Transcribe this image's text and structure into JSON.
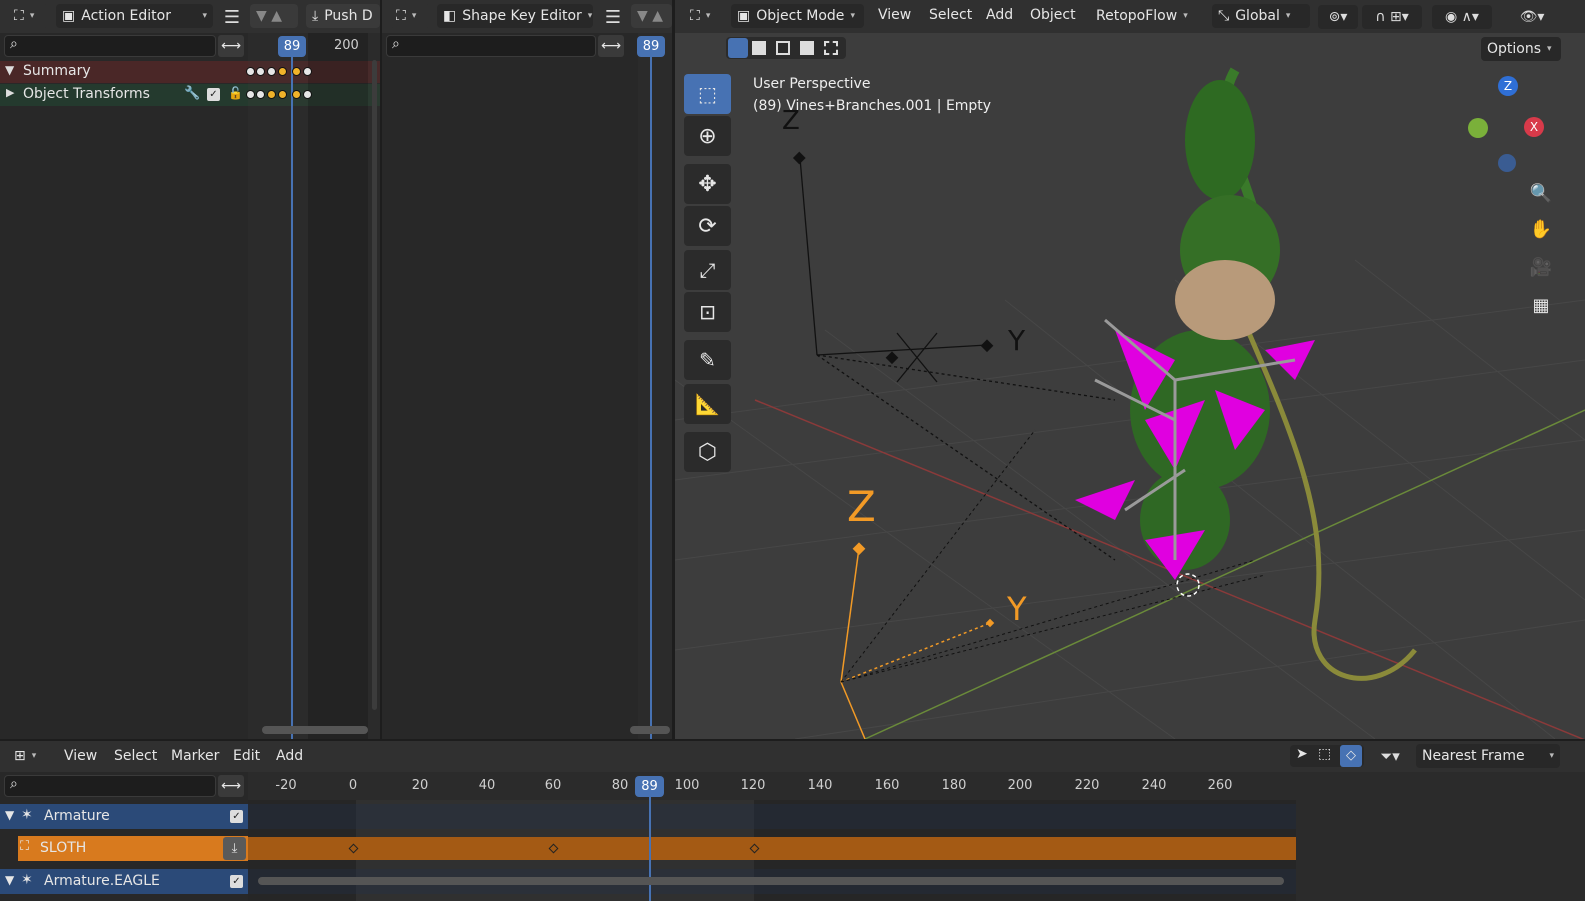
{
  "action_editor": {
    "mode": "Action Editor",
    "push_label": "Push D",
    "current_frame": "89",
    "frame_200": "200",
    "summary_label": "Summary",
    "object_transforms_label": "Object Transforms"
  },
  "shape_key_editor": {
    "mode": "Shape Key Editor",
    "current_frame": "89"
  },
  "viewport": {
    "mode": "Object Mode",
    "menus": [
      "View",
      "Select",
      "Add",
      "Object"
    ],
    "retopoflow": "RetopoFlow",
    "orientation": "Global",
    "options_label": "Options",
    "perspective": "User Perspective",
    "object_info": "(89) Vines+Branches.001 | Empty",
    "axis_labels": {
      "z_dim": "Z",
      "y_dim": "Y",
      "z_orange": "Z",
      "y_orange": "Y"
    },
    "gizmo": {
      "z": "Z",
      "x": "X"
    }
  },
  "nla": {
    "menus": [
      "View",
      "Select",
      "Marker",
      "Edit",
      "Add"
    ],
    "snap_mode": "Nearest Frame",
    "current_frame": "89",
    "ticks": [
      "-20",
      "0",
      "20",
      "40",
      "60",
      "80",
      "100",
      "120",
      "140",
      "160",
      "180",
      "200",
      "220",
      "240",
      "260"
    ],
    "tracks": {
      "armature": "Armature",
      "sloth": "SLOTH",
      "armature_eagle": "Armature.EAGLE"
    }
  },
  "colors": {
    "accent": "#4772b3",
    "summary_bg": "#4a2727",
    "transforms_bg": "#243a2e",
    "nla_strip": "#c06b1a",
    "nla_sloth_channel": "#d87a1e",
    "armature_channel": "#2b4a78",
    "magenta": "#e000e0"
  }
}
